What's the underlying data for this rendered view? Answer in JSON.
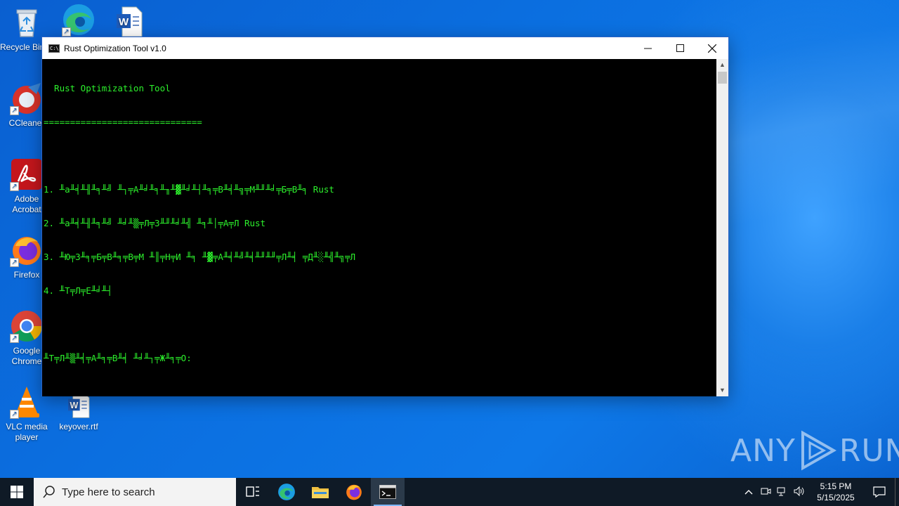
{
  "desktop": {
    "icons": [
      {
        "label": "Recycle Bin",
        "icon": "recycle-bin-icon"
      },
      {
        "label": "",
        "icon": "edge-icon"
      },
      {
        "label": "",
        "icon": "word-document-icon"
      },
      {
        "label": "CCleaner",
        "icon": "ccleaner-icon"
      },
      {
        "label": "Adobe Acrobat",
        "icon": "acrobat-icon"
      },
      {
        "label": "Firefox",
        "icon": "firefox-icon"
      },
      {
        "label": "Google Chrome",
        "icon": "chrome-icon"
      },
      {
        "label": "VLC media player",
        "icon": "vlc-icon"
      },
      {
        "label": "keyover.rtf",
        "icon": "word-document-icon"
      }
    ]
  },
  "window": {
    "title": "Rust Optimization Tool v1.0",
    "console_lines": [
      "  Rust Optimization Tool",
      "==============================",
      "",
      "1. ╨а╨╡╨╢╨╕╨╝ ╨┐╤А╨╛╨╕╨╖╨▓╨╛╨┤╨╕╤В╨╡╨╗╤М╨╜╨╛╤Б╤В╨╕ Rust",
      "2. ╨а╨╡╨╢╨╕╨╝ ╨╛╨▒╤Л╤З╨╜╨╛╨╣ ╨╕╨│╤А╤Л Rust",
      "3. ╨Ю╤З╨╕╤Б╤В╨╕╤В╤М ╨║╤Н╤И ╨╕ ╨▓╤А╨╡╨╝╨╡╨╜╨╜╤Л╨╡ ╤Д╨░╨╣╨╗╤Л",
      "4. ╨Т╤Л╤Е╨╛╨┤",
      "",
      "╨Т╤Л╨▒╨╡╤А╨╕╤В╨╡ ╨╛╨┐╤Ж╨╕╤О:"
    ]
  },
  "watermark": {
    "left": "ANY",
    "right": "RUN"
  },
  "taskbar": {
    "search_placeholder": "Type here to search",
    "time": "5:15 PM",
    "date": "5/15/2025"
  },
  "colors": {
    "console_text": "#2cf02c",
    "taskbar": "#0f1a26"
  }
}
